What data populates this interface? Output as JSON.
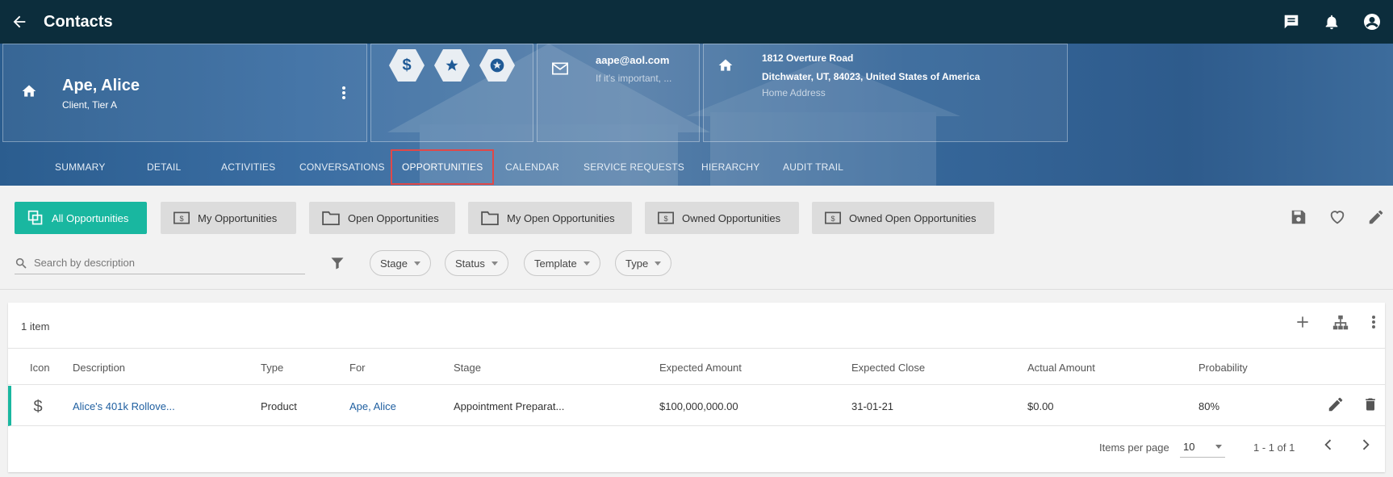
{
  "appbar": {
    "title": "Contacts"
  },
  "contact": {
    "name": "Ape, Alice",
    "subtitle": "Client, Tier A",
    "email": "aape@aol.com",
    "email_note": "If it's important, ...",
    "address_line1": "1812 Overture Road",
    "address_line2": "Ditchwater, UT, 84023, United States of America",
    "address_type": "Home Address"
  },
  "tabs": [
    "SUMMARY",
    "DETAIL",
    "ACTIVITIES",
    "CONVERSATIONS",
    "OPPORTUNITIES",
    "CALENDAR",
    "SERVICE REQUESTS",
    "HIERARCHY",
    "AUDIT TRAIL"
  ],
  "active_tab": "OPPORTUNITIES",
  "views": [
    "All Opportunities",
    "My Opportunities",
    "Open Opportunities",
    "My Open Opportunities",
    "Owned Opportunities",
    "Owned Open Opportunities"
  ],
  "search": {
    "placeholder": "Search by description"
  },
  "filters": [
    "Stage",
    "Status",
    "Template",
    "Type"
  ],
  "table": {
    "count": "1 item",
    "columns": [
      "Icon",
      "Description",
      "Type",
      "For",
      "Stage",
      "Expected Amount",
      "Expected Close",
      "Actual Amount",
      "Probability"
    ],
    "rows": [
      {
        "icon": "dollar-icon",
        "description": "Alice's 401k Rollove...",
        "type": "Product",
        "for": "Ape, Alice",
        "stage": "Appointment Preparat...",
        "expected_amount": "$100,000,000.00",
        "expected_close": "31-01-21",
        "actual_amount": "$0.00",
        "probability": "80%"
      }
    ]
  },
  "pager": {
    "items_per_page_label": "Items per page",
    "items_per_page": "10",
    "range": "1 - 1 of 1"
  },
  "colors": {
    "appbar": "#0c2d3c",
    "accent": "#19b7a0",
    "link": "#1f5fa0",
    "active_tab_outline": "#e04848"
  }
}
